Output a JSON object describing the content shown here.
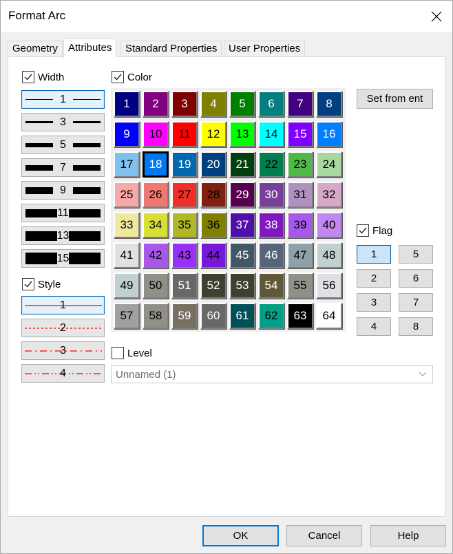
{
  "window": {
    "title": "Format Arc"
  },
  "tabs": [
    {
      "label": "Geometry",
      "active": false
    },
    {
      "label": "Attributes",
      "active": true
    },
    {
      "label": "Standard Properties",
      "active": false
    },
    {
      "label": "User Properties",
      "active": false
    }
  ],
  "width_section": {
    "label": "Width",
    "checked": true,
    "options": [
      "1",
      "3",
      "5",
      "7",
      "9",
      "11",
      "13",
      "15"
    ],
    "selected": "1"
  },
  "style_section": {
    "label": "Style",
    "checked": true,
    "options": [
      "1",
      "2",
      "3",
      "4"
    ],
    "selected": "1",
    "line_color": "#ff0000"
  },
  "color_section": {
    "label": "Color",
    "checked": true,
    "selected": "18",
    "swatches": [
      {
        "n": "1",
        "bg": "#000080",
        "fg": "#ffffff"
      },
      {
        "n": "2",
        "bg": "#800080",
        "fg": "#ffffff"
      },
      {
        "n": "3",
        "bg": "#800000",
        "fg": "#ffffff"
      },
      {
        "n": "4",
        "bg": "#808000",
        "fg": "#ffffff"
      },
      {
        "n": "5",
        "bg": "#008000",
        "fg": "#ffffff"
      },
      {
        "n": "6",
        "bg": "#008080",
        "fg": "#ffffff"
      },
      {
        "n": "7",
        "bg": "#400080",
        "fg": "#ffffff"
      },
      {
        "n": "8",
        "bg": "#004080",
        "fg": "#ffffff"
      },
      {
        "n": "9",
        "bg": "#0000ff",
        "fg": "#ffffff"
      },
      {
        "n": "10",
        "bg": "#ff00ff",
        "fg": "#000000"
      },
      {
        "n": "11",
        "bg": "#ff0000",
        "fg": "#000000"
      },
      {
        "n": "12",
        "bg": "#ffff00",
        "fg": "#000000"
      },
      {
        "n": "13",
        "bg": "#00ff00",
        "fg": "#000000"
      },
      {
        "n": "14",
        "bg": "#00ffff",
        "fg": "#000000"
      },
      {
        "n": "15",
        "bg": "#8000ff",
        "fg": "#ffffff"
      },
      {
        "n": "16",
        "bg": "#0080ff",
        "fg": "#ffffff"
      },
      {
        "n": "17",
        "bg": "#80c0ec",
        "fg": "#000000"
      },
      {
        "n": "18",
        "bg": "#0078f0",
        "fg": "#ffffff"
      },
      {
        "n": "19",
        "bg": "#0068b0",
        "fg": "#ffffff"
      },
      {
        "n": "20",
        "bg": "#004080",
        "fg": "#ffffff"
      },
      {
        "n": "21",
        "bg": "#004010",
        "fg": "#ffffff"
      },
      {
        "n": "22",
        "bg": "#008050",
        "fg": "#000000"
      },
      {
        "n": "23",
        "bg": "#50b848",
        "fg": "#000000"
      },
      {
        "n": "24",
        "bg": "#a8d8a0",
        "fg": "#000000"
      },
      {
        "n": "25",
        "bg": "#f8a8a8",
        "fg": "#000000"
      },
      {
        "n": "26",
        "bg": "#f07870",
        "fg": "#000000"
      },
      {
        "n": "27",
        "bg": "#f03028",
        "fg": "#000000"
      },
      {
        "n": "28",
        "bg": "#802010",
        "fg": "#000000"
      },
      {
        "n": "29",
        "bg": "#580050",
        "fg": "#ffffff"
      },
      {
        "n": "30",
        "bg": "#784098",
        "fg": "#ffffff"
      },
      {
        "n": "31",
        "bg": "#b090c0",
        "fg": "#000000"
      },
      {
        "n": "32",
        "bg": "#d8a8c8",
        "fg": "#000000"
      },
      {
        "n": "33",
        "bg": "#f0e8a0",
        "fg": "#000000"
      },
      {
        "n": "34",
        "bg": "#d8e038",
        "fg": "#000000"
      },
      {
        "n": "35",
        "bg": "#b0b828",
        "fg": "#000000"
      },
      {
        "n": "36",
        "bg": "#808000",
        "fg": "#000000"
      },
      {
        "n": "37",
        "bg": "#5010a8",
        "fg": "#ffffff"
      },
      {
        "n": "38",
        "bg": "#8018c0",
        "fg": "#ffffff"
      },
      {
        "n": "39",
        "bg": "#a858e8",
        "fg": "#000000"
      },
      {
        "n": "40",
        "bg": "#c088f0",
        "fg": "#000000"
      },
      {
        "n": "41",
        "bg": "#e0e0e0",
        "fg": "#000000"
      },
      {
        "n": "42",
        "bg": "#a858e8",
        "fg": "#000000"
      },
      {
        "n": "43",
        "bg": "#9830f8",
        "fg": "#000000"
      },
      {
        "n": "44",
        "bg": "#7818d8",
        "fg": "#000000"
      },
      {
        "n": "45",
        "bg": "#405868",
        "fg": "#ffffff"
      },
      {
        "n": "46",
        "bg": "#586478",
        "fg": "#ffffff"
      },
      {
        "n": "47",
        "bg": "#90a0a8",
        "fg": "#000000"
      },
      {
        "n": "48",
        "bg": "#c0d0d0",
        "fg": "#000000"
      },
      {
        "n": "49",
        "bg": "#c0d0d0",
        "fg": "#000000"
      },
      {
        "n": "50",
        "bg": "#909088",
        "fg": "#000000"
      },
      {
        "n": "51",
        "bg": "#686868",
        "fg": "#ffffff"
      },
      {
        "n": "52",
        "bg": "#404030",
        "fg": "#ffffff"
      },
      {
        "n": "53",
        "bg": "#404030",
        "fg": "#ffffff"
      },
      {
        "n": "54",
        "bg": "#605838",
        "fg": "#ffffff"
      },
      {
        "n": "55",
        "bg": "#909088",
        "fg": "#000000"
      },
      {
        "n": "56",
        "bg": "#e0e0e4",
        "fg": "#000000"
      },
      {
        "n": "57",
        "bg": "#a0a0a0",
        "fg": "#000000"
      },
      {
        "n": "58",
        "bg": "#909088",
        "fg": "#000000"
      },
      {
        "n": "59",
        "bg": "#787060",
        "fg": "#ffffff"
      },
      {
        "n": "60",
        "bg": "#686868",
        "fg": "#ffffff"
      },
      {
        "n": "61",
        "bg": "#005058",
        "fg": "#ffffff"
      },
      {
        "n": "62",
        "bg": "#00a088",
        "fg": "#000000"
      },
      {
        "n": "63",
        "bg": "#000000",
        "fg": "#ffffff"
      },
      {
        "n": "64",
        "bg": "#ffffff",
        "fg": "#000000"
      }
    ],
    "set_from_ent_label": "Set from ent"
  },
  "flag_section": {
    "label": "Flag",
    "checked": true,
    "buttons": [
      "1",
      "2",
      "3",
      "4",
      "5",
      "6",
      "7",
      "8"
    ],
    "active": [
      "1"
    ]
  },
  "level_section": {
    "label": "Level",
    "checked": false,
    "value": "Unnamed (1)"
  },
  "footer": {
    "ok_label": "OK",
    "cancel_label": "Cancel",
    "help_label": "Help"
  }
}
